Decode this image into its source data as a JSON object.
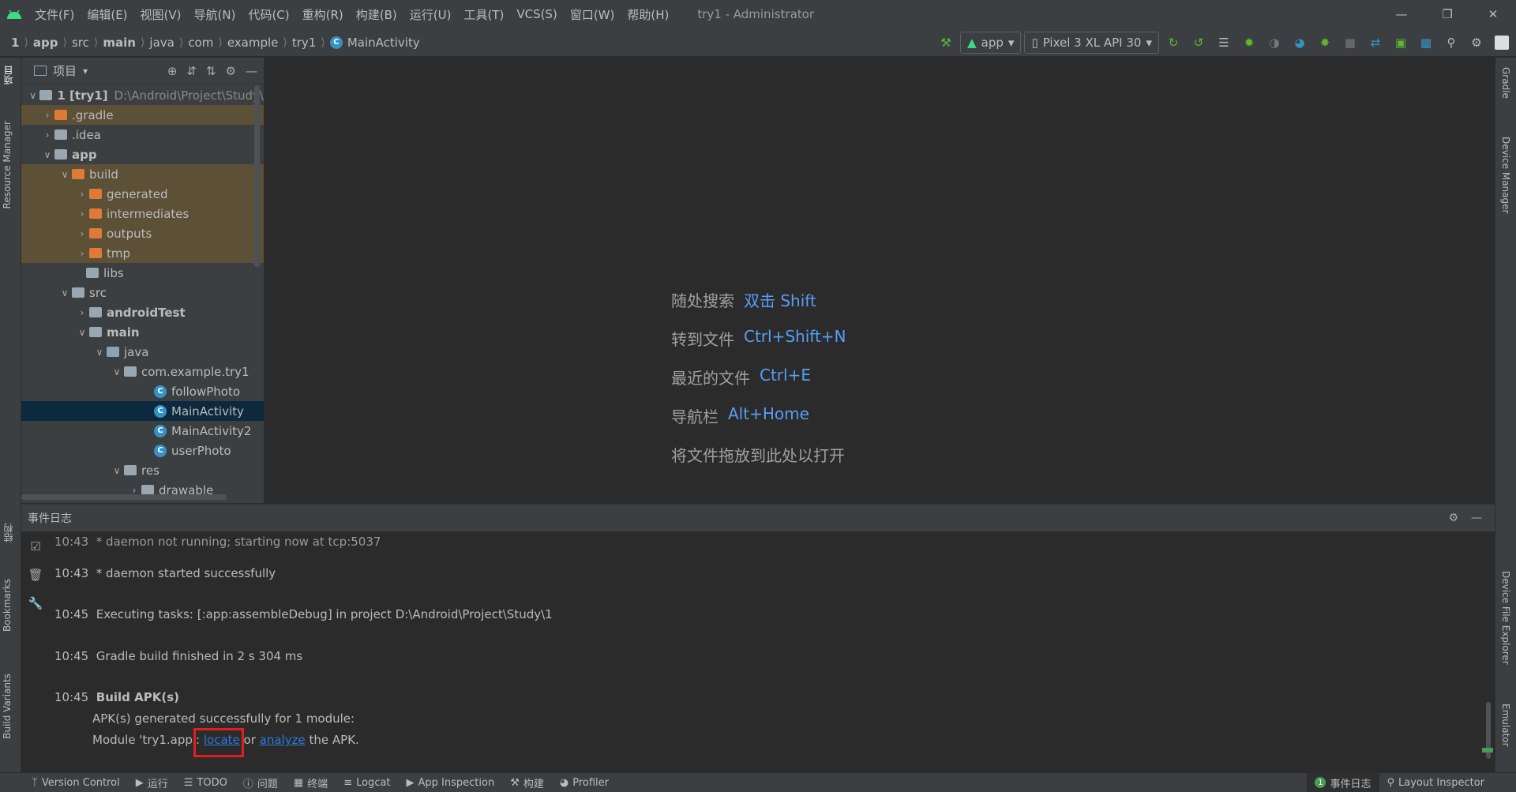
{
  "menu": [
    "文件(F)",
    "编辑(E)",
    "视图(V)",
    "导航(N)",
    "代码(C)",
    "重构(R)",
    "构建(B)",
    "运行(U)",
    "工具(T)",
    "VCS(S)",
    "窗口(W)",
    "帮助(H)"
  ],
  "window_title": "try1 - Administrator",
  "breadcrumb": [
    "1",
    "app",
    "src",
    "main",
    "java",
    "com",
    "example",
    "try1",
    "MainActivity"
  ],
  "run_config": "app",
  "device": "Pixel 3 XL API 30",
  "left_tabs": [
    "项目",
    "Resource Manager",
    "结构",
    "Bookmarks",
    "Build Variants"
  ],
  "right_tabs": [
    "Gradle",
    "Device Manager",
    "Device File Explorer",
    "Emulator"
  ],
  "project_panel": {
    "title": "项目",
    "root_label": "1 [try1]",
    "root_path": "D:\\Android\\Project\\Study\\",
    "rows": [
      {
        "label": ".gradle"
      },
      {
        "label": ".idea"
      },
      {
        "label": "app"
      },
      {
        "label": "build"
      },
      {
        "label": "generated"
      },
      {
        "label": "intermediates"
      },
      {
        "label": "outputs"
      },
      {
        "label": "tmp"
      },
      {
        "label": "libs"
      },
      {
        "label": "src"
      },
      {
        "label": "androidTest"
      },
      {
        "label": "main"
      },
      {
        "label": "java"
      },
      {
        "label": "com.example.try1"
      },
      {
        "label": "followPhoto"
      },
      {
        "label": "MainActivity"
      },
      {
        "label": "MainActivity2"
      },
      {
        "label": "userPhoto"
      },
      {
        "label": "res"
      },
      {
        "label": "drawable"
      }
    ]
  },
  "editor_hints": [
    {
      "label": "随处搜索",
      "key": "双击 Shift"
    },
    {
      "label": "转到文件",
      "key": "Ctrl+Shift+N"
    },
    {
      "label": "最近的文件",
      "key": "Ctrl+E"
    },
    {
      "label": "导航栏",
      "key": "Alt+Home"
    },
    {
      "label": "将文件拖放到此处以打开",
      "key": ""
    }
  ],
  "event_log": {
    "title": "事件日志",
    "entries": [
      {
        "time": "10:43",
        "text": "* daemon not running; starting now at tcp:5037"
      },
      {
        "time": "10:43",
        "text": "* daemon started successfully"
      },
      {
        "time": "10:45",
        "text": "Executing tasks: [:app:assembleDebug] in project D:\\Android\\Project\\Study\\1"
      },
      {
        "time": "10:45",
        "text": "Gradle build finished in 2 s 304 ms"
      },
      {
        "time": "10:45",
        "text": "Build APK(s)"
      }
    ],
    "apk_line1": "APK(s) generated successfully for 1 module:",
    "apk_line2_prefix": "Module 'try1.app': ",
    "locate_link": "locate",
    "or_text": " or ",
    "analyze_link": "analyze",
    "apk_line2_suffix": " the APK."
  },
  "status_bar": {
    "version_control": "Version Control",
    "run": "运行",
    "todo": "TODO",
    "problems": "问题",
    "terminal": "终端",
    "logcat": "Logcat",
    "app_inspection": "App Inspection",
    "build": "构建",
    "profiler": "Profiler",
    "event_log_badge": "1",
    "event_log": "事件日志",
    "layout_inspector": "Layout Inspector"
  },
  "colors": {
    "accent_link": "#287bde",
    "hint_key": "#589df6",
    "excluded_bg": "#5c5037",
    "selection_bg": "#0d293e",
    "highlight_box": "#e0201f"
  }
}
